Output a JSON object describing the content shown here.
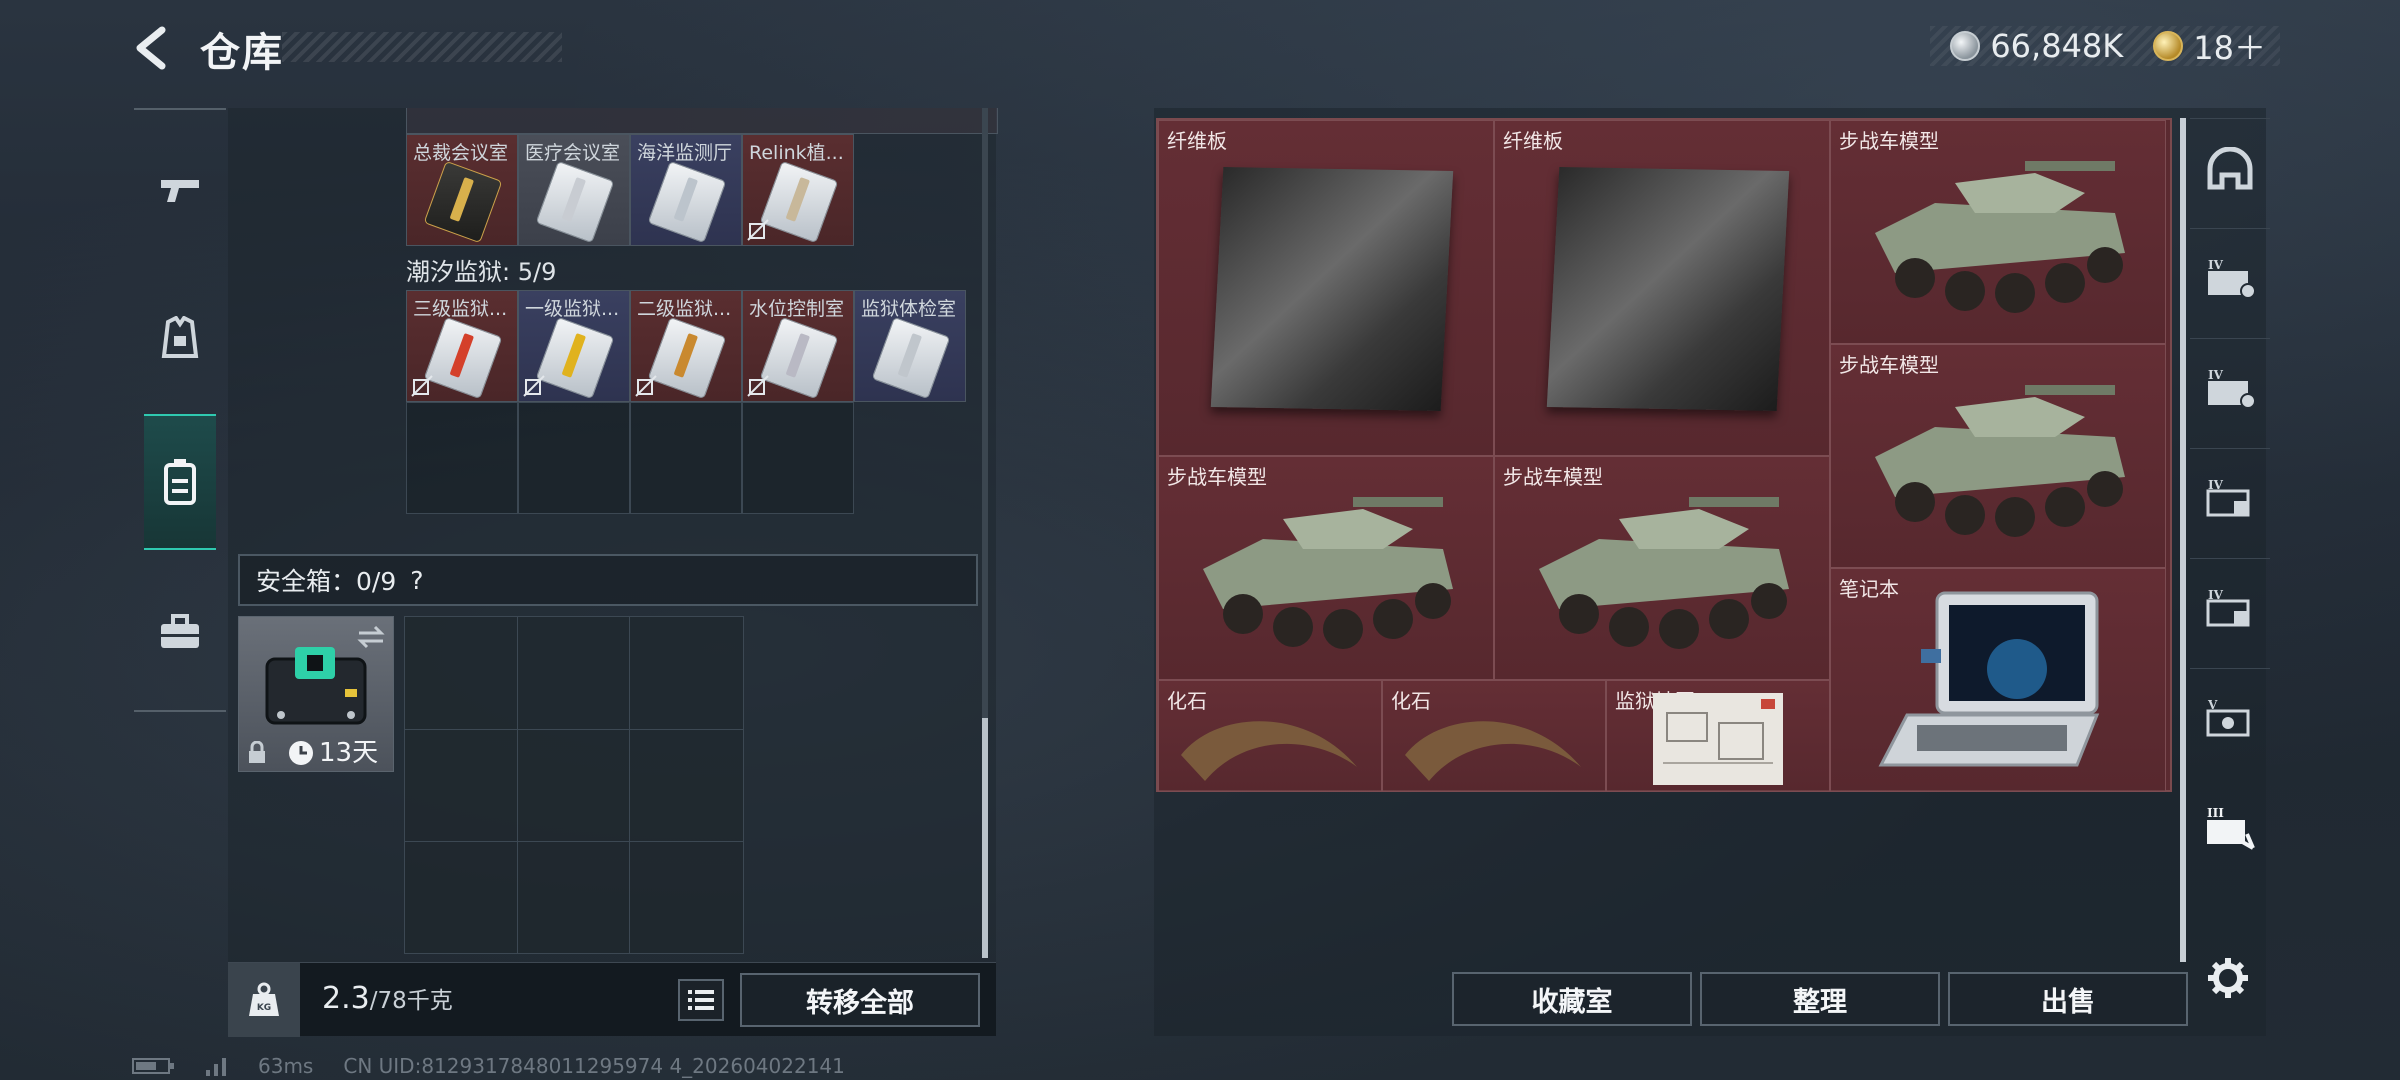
{
  "header": {
    "title": "仓库",
    "currency_silver": "66,848K",
    "currency_gold": "18＋"
  },
  "left_rail": {
    "items": [
      {
        "name": "weapon-icon"
      },
      {
        "name": "armor-icon"
      },
      {
        "name": "backpack-icon",
        "active": true
      },
      {
        "name": "toolbox-icon"
      }
    ]
  },
  "inventory": {
    "keycards_row1": [
      {
        "name": "总裁会议室",
        "color": "gold"
      },
      {
        "name": "医疗会议室",
        "color": "white"
      },
      {
        "name": "海洋监测厅",
        "color": "white"
      },
      {
        "name": "Relink植...",
        "color": "white"
      }
    ],
    "prison_section": {
      "label": "潮汐监狱: 5/9"
    },
    "prison_cards": [
      {
        "name": "三级监狱...",
        "stripe": "#d4402a"
      },
      {
        "name": "一级监狱...",
        "stripe": "#e0b21e"
      },
      {
        "name": "二级监狱...",
        "stripe": "#c9892f"
      },
      {
        "name": "水位控制室",
        "stripe": "#b9b9c4"
      },
      {
        "name": "监狱体检室",
        "stripe": "#c0c6cc"
      }
    ],
    "safe_box": {
      "label": "安全箱：0/9",
      "help": "?",
      "timer": "13天"
    },
    "weight": {
      "current": "2.3",
      "max": "/78千克"
    },
    "transfer_all": "转移全部"
  },
  "stash": {
    "items": [
      {
        "name": "纤维板",
        "type": "board"
      },
      {
        "name": "纤维板",
        "type": "board"
      },
      {
        "name": "步战车模型",
        "type": "tank"
      },
      {
        "name": "步战车模型",
        "type": "tank"
      },
      {
        "name": "步战车模型",
        "type": "tank"
      },
      {
        "name": "步战车模型",
        "type": "tank"
      },
      {
        "name": "笔记本",
        "type": "laptop"
      },
      {
        "name": "化石",
        "type": "claw"
      },
      {
        "name": "化石",
        "type": "claw"
      },
      {
        "name": "监狱地图4",
        "type": "map"
      }
    ],
    "buttons": {
      "collection": "收藏室",
      "sort": "整理",
      "sell": "出售"
    }
  },
  "right_rail": [
    "helmet-icon",
    "card-iv-icon",
    "card-iv-icon",
    "card-iv-icon",
    "card-iv-icon",
    "card-v-icon",
    "card-iii-icon"
  ],
  "status": {
    "ping": "63ms",
    "uid": "CN UID:8129317848011295974 4_202604022141"
  }
}
